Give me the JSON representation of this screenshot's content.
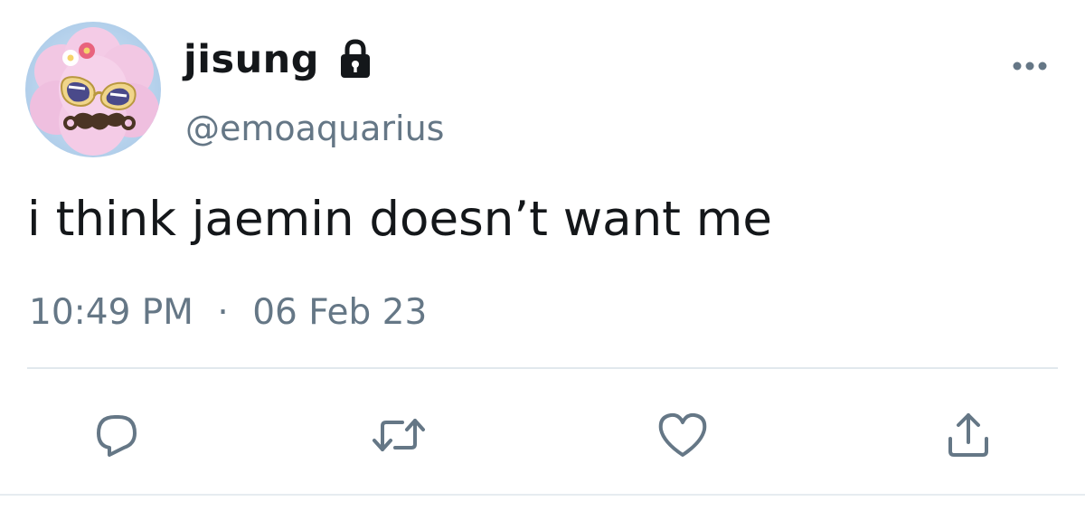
{
  "tweet": {
    "display_name": "jisung",
    "handle": "@emoaquarius",
    "text": "i think jaemin doesn’t want me",
    "time": "10:49 PM",
    "separator": "·",
    "date": "06 Feb 23",
    "protected": true
  },
  "icons": {
    "lock": "lock-icon",
    "more": "more-icon",
    "reply": "reply-icon",
    "retweet": "retweet-icon",
    "like": "heart-icon",
    "share": "share-icon"
  },
  "colors": {
    "text_primary": "#14171a",
    "text_secondary": "#657786",
    "divider": "#e1e8ed",
    "action_icon": "#657786"
  }
}
